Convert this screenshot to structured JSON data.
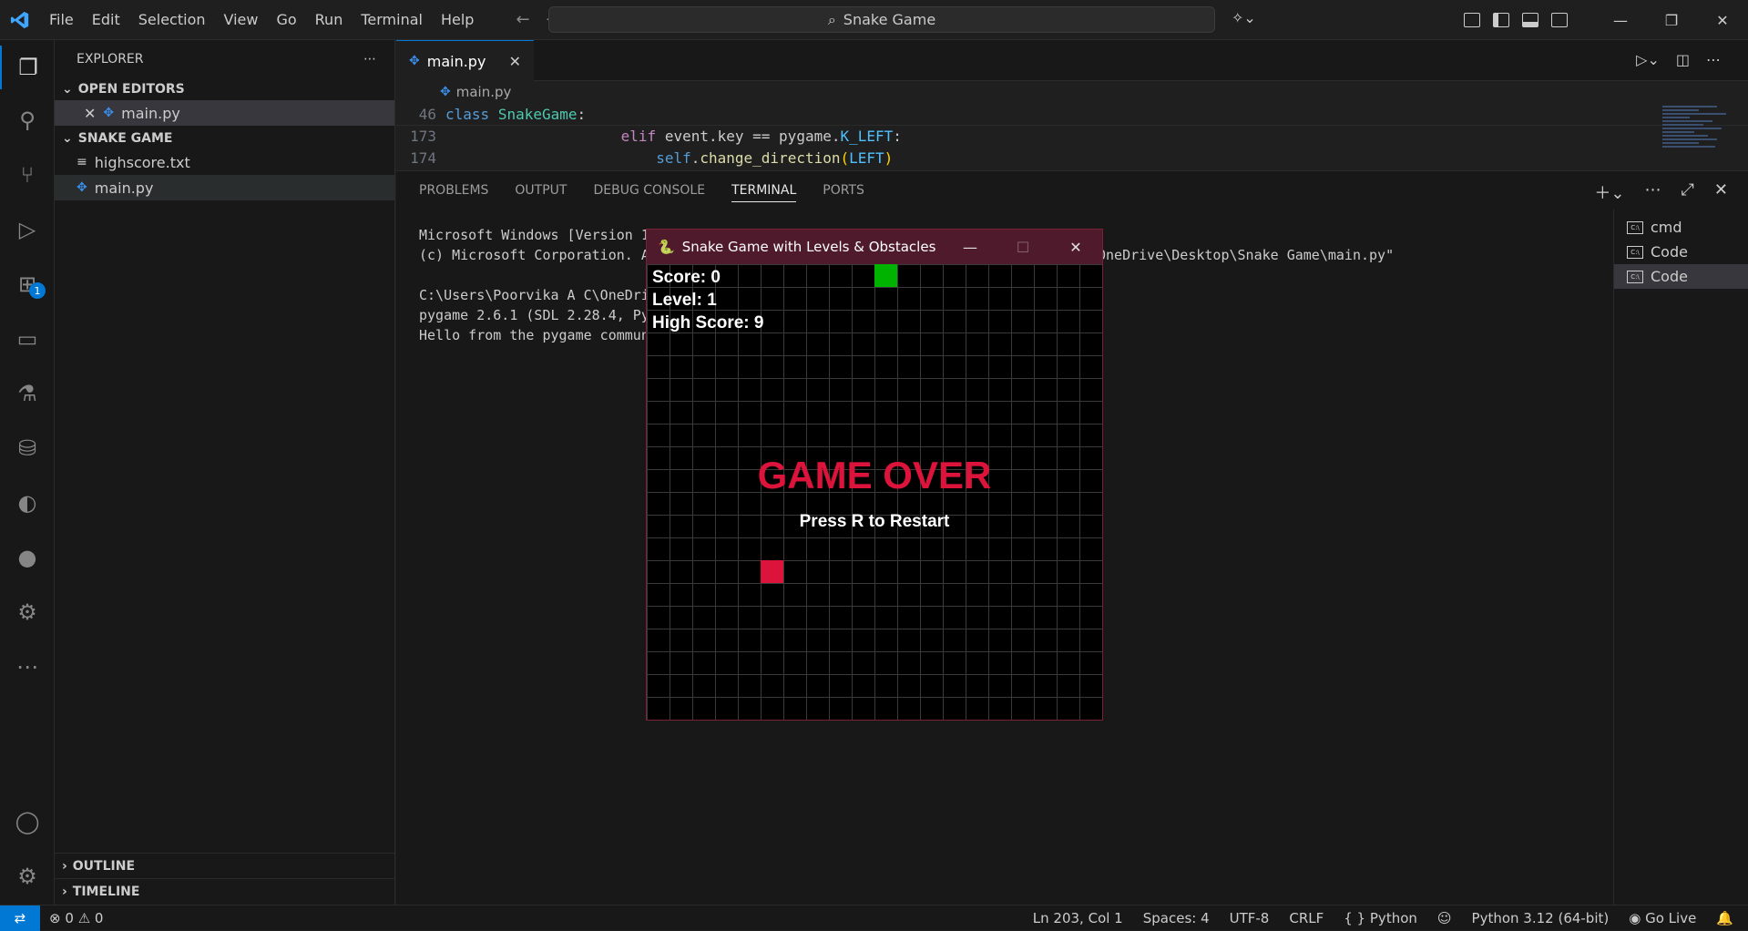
{
  "menu": [
    "File",
    "Edit",
    "Selection",
    "View",
    "Go",
    "Run",
    "Terminal",
    "Help"
  ],
  "search": {
    "text": "Snake Game"
  },
  "sidebar": {
    "title": "EXPLORER",
    "open_editors": "OPEN EDITORS",
    "open_file": "main.py",
    "folder": "SNAKE GAME",
    "files": [
      "highscore.txt",
      "main.py"
    ],
    "outline": "OUTLINE",
    "timeline": "TIMELINE"
  },
  "activity": {
    "extensions_badge": "1"
  },
  "editor": {
    "tab": "main.py",
    "breadcrumb": "main.py",
    "lines": [
      {
        "num": "46",
        "text": "class SnakeGame:"
      },
      {
        "num": "173",
        "text": "elif event.key == pygame.K_LEFT:"
      },
      {
        "num": "174",
        "text": "self.change_direction(LEFT)"
      }
    ]
  },
  "panel": {
    "tabs": [
      "PROBLEMS",
      "OUTPUT",
      "DEBUG CONSOLE",
      "TERMINAL",
      "PORTS"
    ],
    "terminal_lines": [
      "Microsoft Windows [Version 1",
      "(c) Microsoft Corporation. A",
      "",
      "C:\\Users\\Poorvika A C\\OneDri",
      "pygame 2.6.1 (SDL 2.28.4, Py",
      "Hello from the pygame commun"
    ],
    "terminal_tail": "OneDrive\\Desktop\\Snake Game\\main.py\"",
    "terminals": [
      "cmd",
      "Code",
      "Code"
    ]
  },
  "game": {
    "window_title": "Snake Game with Levels & Obstacles",
    "score": "Score: 0",
    "level": "Level: 1",
    "high_score": "High Score: 9",
    "game_over": "GAME OVER",
    "restart": "Press R to Restart",
    "colors": {
      "snake": "#00b300",
      "food": "#dc143c"
    }
  },
  "status": {
    "errors": "0",
    "warnings": "0",
    "position": "Ln 203, Col 1",
    "spaces": "Spaces: 4",
    "encoding": "UTF-8",
    "eol": "CRLF",
    "language": "Python",
    "interpreter": "Python 3.12 (64-bit)",
    "golive": "Go Live"
  }
}
